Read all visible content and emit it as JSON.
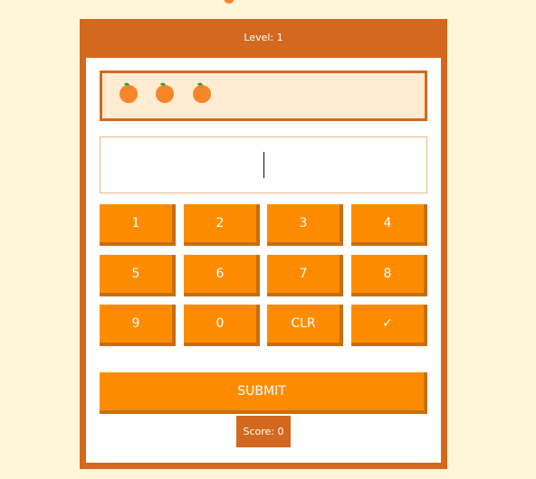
{
  "game": {
    "level_label": "Level: 1",
    "fruit_count": 3,
    "fruit_icon": "orange-icon",
    "answer_value": "",
    "score_label": "Score: 0",
    "keypad": [
      "1",
      "2",
      "3",
      "4",
      "5",
      "6",
      "7",
      "8",
      "9",
      "0",
      "CLR",
      "✓"
    ],
    "submit_label": "SUBMIT"
  },
  "colors": {
    "frame": "#d2691e",
    "button": "#ff8c00",
    "button_shadow": "#c76e12",
    "background": "#fff5d9",
    "fruit_box": "#ffecd2",
    "orange": "#f7862a",
    "leaf": "#2e9e3e"
  }
}
